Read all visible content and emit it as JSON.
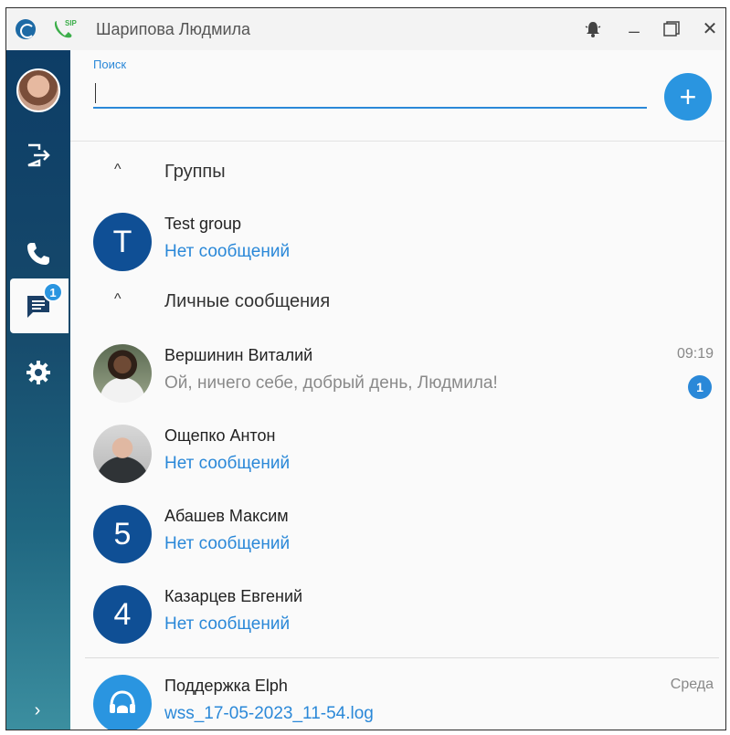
{
  "window": {
    "title": "Шарипова Людмила"
  },
  "titlebar": {
    "logo_icon": "app-logo-icon",
    "sip_icon": "phone-sip-icon",
    "sip_label": "SIP",
    "bell_icon": "bell-icon",
    "minimize_label": "_",
    "maximize_icon": "maximize-icon",
    "close_label": "✕"
  },
  "sidebar": {
    "items": [
      {
        "icon": "avatar",
        "name": "user-avatar"
      },
      {
        "icon": "logout-icon"
      },
      {
        "icon": "phone-icon"
      },
      {
        "icon": "chat-icon",
        "badge": "1",
        "active": true
      },
      {
        "icon": "gear-icon"
      }
    ],
    "expand_label": "›"
  },
  "search": {
    "label": "Поиск",
    "value": "",
    "placeholder": ""
  },
  "add_button": {
    "label": "+"
  },
  "sections": [
    {
      "title": "Группы",
      "chevron": "^"
    },
    {
      "title": "Личные сообщения",
      "chevron": "^"
    }
  ],
  "groups": [
    {
      "initial": "T",
      "name": "Test group",
      "message": "Нет сообщений"
    }
  ],
  "personal": [
    {
      "name": "Вершинин Виталий",
      "message": "Ой, ничего себе, добрый день, Людмила!",
      "time": "09:19",
      "badge": "1"
    },
    {
      "name": "Ощепко Антон",
      "message": "Нет сообщений"
    },
    {
      "initial": "5",
      "name": "Абашев Максим",
      "message": "Нет сообщений"
    },
    {
      "initial": "4",
      "name": "Казарцев Евгений",
      "message": "Нет сообщений"
    }
  ],
  "support": {
    "name": "Поддержка Elph",
    "message": "wss_17-05-2023_11-54.log",
    "time": "Среда"
  },
  "colors": {
    "accent": "#2a88d8",
    "sidebar_top": "#0d3d66",
    "avatar_blue": "#0f4f95"
  }
}
